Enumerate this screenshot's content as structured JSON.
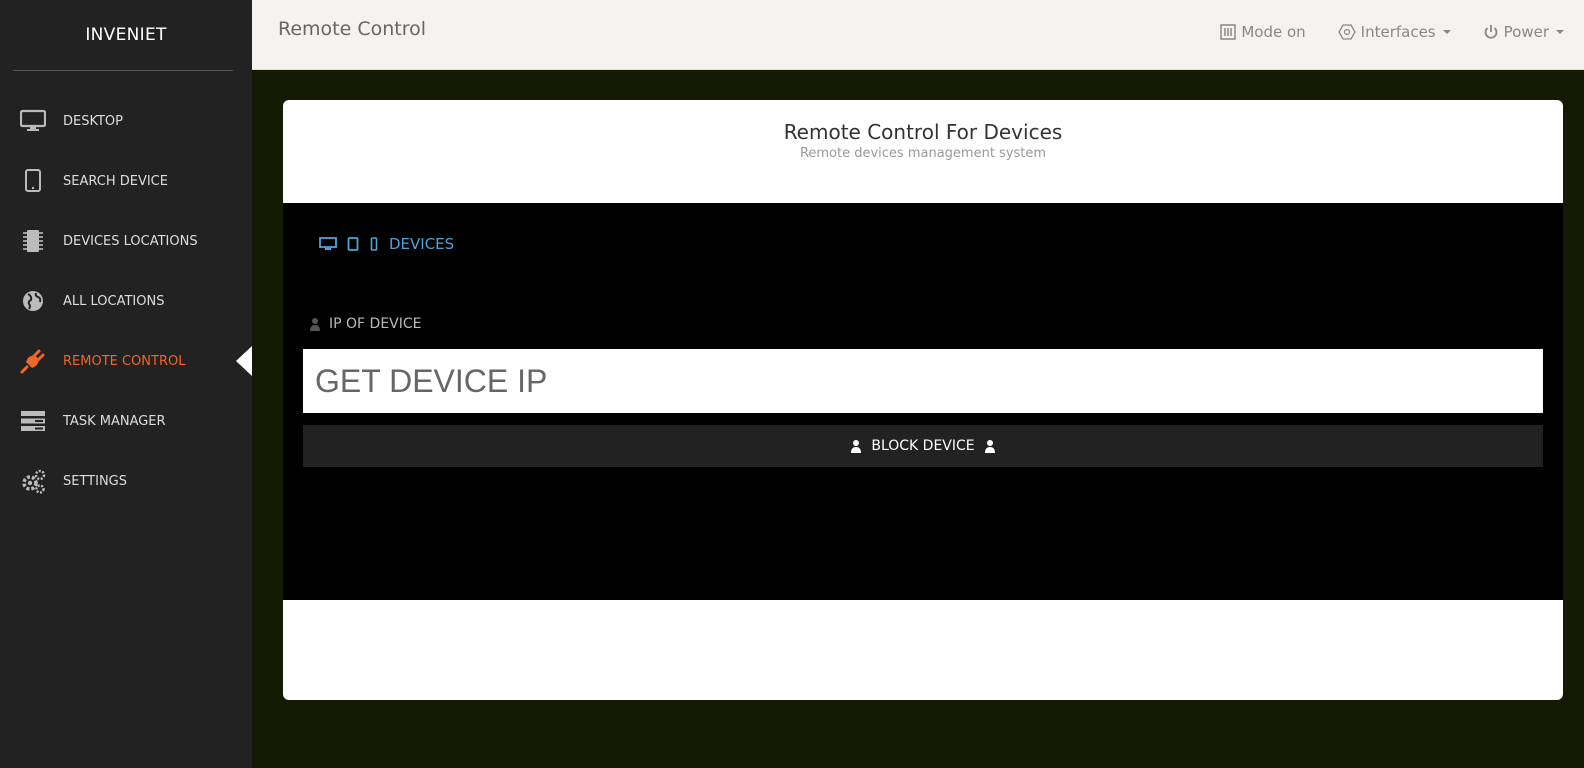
{
  "brand": "INVENIET",
  "sidebar": {
    "items": [
      {
        "label": "DESKTOP",
        "icon": "monitor-icon"
      },
      {
        "label": "SEARCH DEVICE",
        "icon": "tablet-icon"
      },
      {
        "label": "DEVICES LOCATIONS",
        "icon": "chip-icon"
      },
      {
        "label": "ALL LOCATIONS",
        "icon": "globe-icon"
      },
      {
        "label": "REMOTE CONTROL",
        "icon": "plug-icon",
        "active": true
      },
      {
        "label": "TASK MANAGER",
        "icon": "server-icon"
      },
      {
        "label": "SETTINGS",
        "icon": "gears-icon"
      }
    ]
  },
  "header": {
    "title": "Remote Control",
    "mode": "Mode on",
    "interfaces": "Interfaces",
    "power": "Power"
  },
  "card": {
    "title": "Remote Control For Devices",
    "subtitle": "Remote devices management system",
    "tab": "DEVICES",
    "ip_label": "IP OF DEVICE",
    "ip_placeholder": "GET DEVICE IP",
    "block_button": "BLOCK DEVICE"
  },
  "colors": {
    "sidebar_bg": "#222222",
    "accent": "#f0672b",
    "link": "#4fa3d9",
    "page_bg": "#151a04",
    "topbar_bg": "#f4f3ef"
  }
}
